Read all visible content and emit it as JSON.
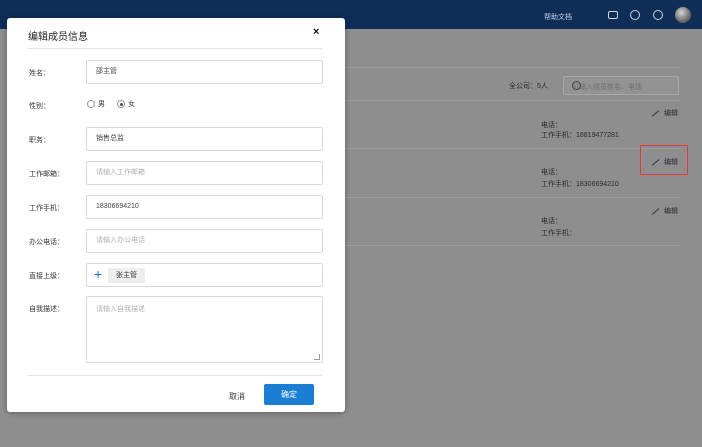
{
  "topbar": {
    "help_label": "帮助文档"
  },
  "background": {
    "company_count": "全公司：5人",
    "search_placeholder": "可输入成员姓名、电话",
    "members": [
      {
        "phone_label": "电话：",
        "mobile": "工作手机：18819477281",
        "edit": "编辑"
      },
      {
        "phone_label": "电话：",
        "mobile": "工作手机：18306694210",
        "edit": "编辑"
      },
      {
        "phone_label": "电话：",
        "mobile": "工作手机：",
        "edit": "编辑"
      }
    ]
  },
  "modal": {
    "title": "编辑成员信息",
    "close": "×",
    "fields": {
      "name_label": "姓名：",
      "name_value": "邵主管",
      "gender_label": "性别：",
      "gender_male": "男",
      "gender_female": "女",
      "gender_selected": "女",
      "title_label": "职务：",
      "title_value": "销售总监",
      "email_label": "工作邮箱：",
      "email_placeholder": "请输入工作邮箱",
      "mobile_label": "工作手机：",
      "mobile_value": "18306694210",
      "office_phone_label": "办公电话：",
      "office_phone_placeholder": "请输入办公电话",
      "supervisor_label": "直接上级：",
      "supervisor_tag": "张主管",
      "description_label": "自我描述：",
      "description_placeholder": "请输入自我描述"
    },
    "cancel_label": "取消",
    "confirm_label": "确定"
  },
  "colors": {
    "primary": "#1a7ed4",
    "topbar": "#0e2e58",
    "highlight": "#e23d3d"
  }
}
